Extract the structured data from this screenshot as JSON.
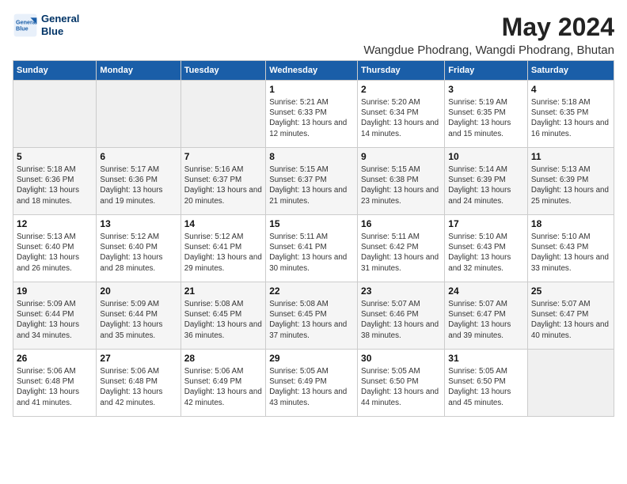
{
  "logo": {
    "line1": "General",
    "line2": "Blue"
  },
  "title": "May 2024",
  "subtitle": "Wangdue Phodrang, Wangdi Phodrang, Bhutan",
  "days_of_week": [
    "Sunday",
    "Monday",
    "Tuesday",
    "Wednesday",
    "Thursday",
    "Friday",
    "Saturday"
  ],
  "weeks": [
    [
      {
        "day": "",
        "info": ""
      },
      {
        "day": "",
        "info": ""
      },
      {
        "day": "",
        "info": ""
      },
      {
        "day": "1",
        "info": "Sunrise: 5:21 AM\nSunset: 6:33 PM\nDaylight: 13 hours and 12 minutes."
      },
      {
        "day": "2",
        "info": "Sunrise: 5:20 AM\nSunset: 6:34 PM\nDaylight: 13 hours and 14 minutes."
      },
      {
        "day": "3",
        "info": "Sunrise: 5:19 AM\nSunset: 6:35 PM\nDaylight: 13 hours and 15 minutes."
      },
      {
        "day": "4",
        "info": "Sunrise: 5:18 AM\nSunset: 6:35 PM\nDaylight: 13 hours and 16 minutes."
      }
    ],
    [
      {
        "day": "5",
        "info": "Sunrise: 5:18 AM\nSunset: 6:36 PM\nDaylight: 13 hours and 18 minutes."
      },
      {
        "day": "6",
        "info": "Sunrise: 5:17 AM\nSunset: 6:36 PM\nDaylight: 13 hours and 19 minutes."
      },
      {
        "day": "7",
        "info": "Sunrise: 5:16 AM\nSunset: 6:37 PM\nDaylight: 13 hours and 20 minutes."
      },
      {
        "day": "8",
        "info": "Sunrise: 5:15 AM\nSunset: 6:37 PM\nDaylight: 13 hours and 21 minutes."
      },
      {
        "day": "9",
        "info": "Sunrise: 5:15 AM\nSunset: 6:38 PM\nDaylight: 13 hours and 23 minutes."
      },
      {
        "day": "10",
        "info": "Sunrise: 5:14 AM\nSunset: 6:39 PM\nDaylight: 13 hours and 24 minutes."
      },
      {
        "day": "11",
        "info": "Sunrise: 5:13 AM\nSunset: 6:39 PM\nDaylight: 13 hours and 25 minutes."
      }
    ],
    [
      {
        "day": "12",
        "info": "Sunrise: 5:13 AM\nSunset: 6:40 PM\nDaylight: 13 hours and 26 minutes."
      },
      {
        "day": "13",
        "info": "Sunrise: 5:12 AM\nSunset: 6:40 PM\nDaylight: 13 hours and 28 minutes."
      },
      {
        "day": "14",
        "info": "Sunrise: 5:12 AM\nSunset: 6:41 PM\nDaylight: 13 hours and 29 minutes."
      },
      {
        "day": "15",
        "info": "Sunrise: 5:11 AM\nSunset: 6:41 PM\nDaylight: 13 hours and 30 minutes."
      },
      {
        "day": "16",
        "info": "Sunrise: 5:11 AM\nSunset: 6:42 PM\nDaylight: 13 hours and 31 minutes."
      },
      {
        "day": "17",
        "info": "Sunrise: 5:10 AM\nSunset: 6:43 PM\nDaylight: 13 hours and 32 minutes."
      },
      {
        "day": "18",
        "info": "Sunrise: 5:10 AM\nSunset: 6:43 PM\nDaylight: 13 hours and 33 minutes."
      }
    ],
    [
      {
        "day": "19",
        "info": "Sunrise: 5:09 AM\nSunset: 6:44 PM\nDaylight: 13 hours and 34 minutes."
      },
      {
        "day": "20",
        "info": "Sunrise: 5:09 AM\nSunset: 6:44 PM\nDaylight: 13 hours and 35 minutes."
      },
      {
        "day": "21",
        "info": "Sunrise: 5:08 AM\nSunset: 6:45 PM\nDaylight: 13 hours and 36 minutes."
      },
      {
        "day": "22",
        "info": "Sunrise: 5:08 AM\nSunset: 6:45 PM\nDaylight: 13 hours and 37 minutes."
      },
      {
        "day": "23",
        "info": "Sunrise: 5:07 AM\nSunset: 6:46 PM\nDaylight: 13 hours and 38 minutes."
      },
      {
        "day": "24",
        "info": "Sunrise: 5:07 AM\nSunset: 6:47 PM\nDaylight: 13 hours and 39 minutes."
      },
      {
        "day": "25",
        "info": "Sunrise: 5:07 AM\nSunset: 6:47 PM\nDaylight: 13 hours and 40 minutes."
      }
    ],
    [
      {
        "day": "26",
        "info": "Sunrise: 5:06 AM\nSunset: 6:48 PM\nDaylight: 13 hours and 41 minutes."
      },
      {
        "day": "27",
        "info": "Sunrise: 5:06 AM\nSunset: 6:48 PM\nDaylight: 13 hours and 42 minutes."
      },
      {
        "day": "28",
        "info": "Sunrise: 5:06 AM\nSunset: 6:49 PM\nDaylight: 13 hours and 42 minutes."
      },
      {
        "day": "29",
        "info": "Sunrise: 5:05 AM\nSunset: 6:49 PM\nDaylight: 13 hours and 43 minutes."
      },
      {
        "day": "30",
        "info": "Sunrise: 5:05 AM\nSunset: 6:50 PM\nDaylight: 13 hours and 44 minutes."
      },
      {
        "day": "31",
        "info": "Sunrise: 5:05 AM\nSunset: 6:50 PM\nDaylight: 13 hours and 45 minutes."
      },
      {
        "day": "",
        "info": ""
      }
    ]
  ]
}
